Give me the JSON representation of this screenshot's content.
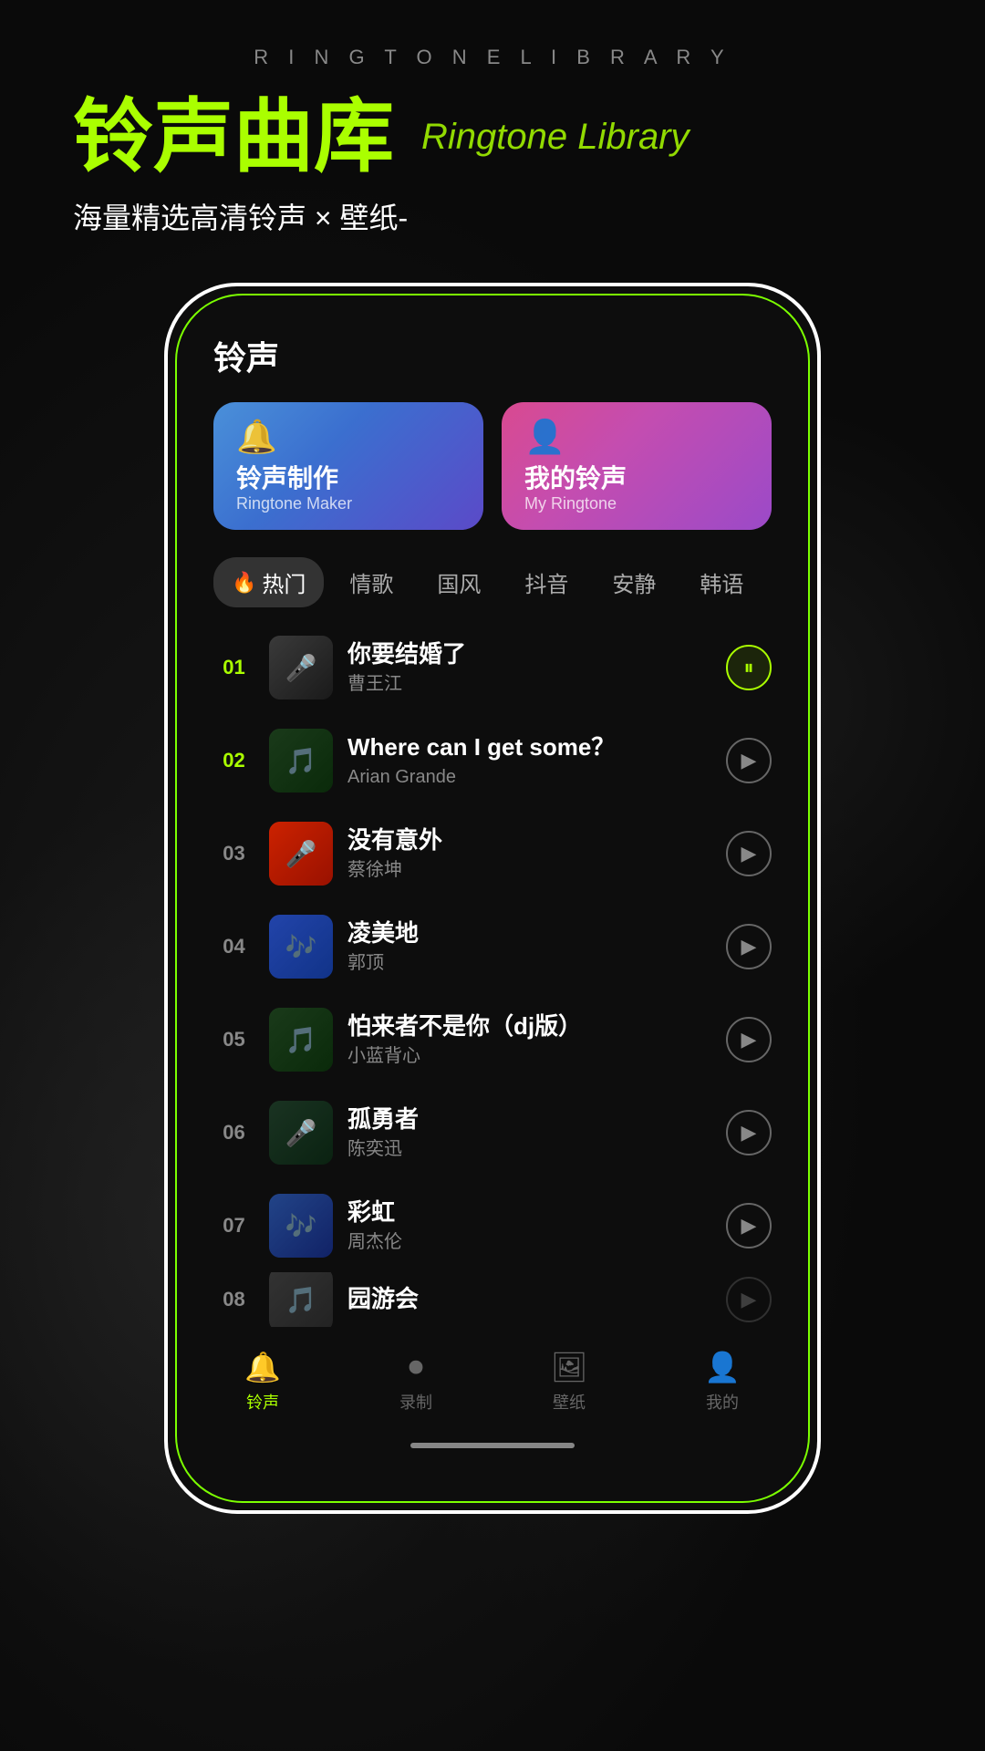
{
  "page": {
    "header_subtitle": "R I N G T O N E   L I B R A R Y",
    "title_cn": "铃声曲库",
    "title_en": "Ringtone Library",
    "description": "海量精选高清铃声 × 壁纸-"
  },
  "phone": {
    "section_title": "铃声",
    "buttons": [
      {
        "id": "ringtone-maker",
        "icon": "🔔",
        "label_cn": "铃声制作",
        "label_en": "Ringtone Maker"
      },
      {
        "id": "my-ringtone",
        "icon": "👤",
        "label_cn": "我的铃声",
        "label_en": "My Ringtone"
      }
    ],
    "categories": [
      {
        "id": "hot",
        "label": "热门",
        "active": true,
        "has_fire": true
      },
      {
        "id": "love",
        "label": "情歌",
        "active": false
      },
      {
        "id": "chinese",
        "label": "国风",
        "active": false
      },
      {
        "id": "douyin",
        "label": "抖音",
        "active": false
      },
      {
        "id": "quiet",
        "label": "安静",
        "active": false
      },
      {
        "id": "korean",
        "label": "韩语",
        "active": false
      }
    ],
    "songs": [
      {
        "number": "01",
        "number_highlighted": true,
        "title": "你要结婚了",
        "artist": "曹王江",
        "playing": true,
        "thumb_class": "thumb-p1"
      },
      {
        "number": "02",
        "number_highlighted": true,
        "title": "Where can I get some？",
        "artist": "Arian Grande",
        "playing": false,
        "thumb_class": "thumb-p2"
      },
      {
        "number": "03",
        "number_highlighted": false,
        "title": "没有意外",
        "artist": "蔡徐坤",
        "playing": false,
        "thumb_class": "thumb-p3"
      },
      {
        "number": "04",
        "number_highlighted": false,
        "title": "凌美地",
        "artist": "郭顶",
        "playing": false,
        "thumb_class": "thumb-p4"
      },
      {
        "number": "05",
        "number_highlighted": false,
        "title": "怕来者不是你（dj版）",
        "artist": "小蓝背心",
        "playing": false,
        "thumb_class": "thumb-p5"
      },
      {
        "number": "06",
        "number_highlighted": false,
        "title": "孤勇者",
        "artist": "陈奕迅",
        "playing": false,
        "thumb_class": "thumb-p6"
      },
      {
        "number": "07",
        "number_highlighted": false,
        "title": "彩虹",
        "artist": "周杰伦",
        "playing": false,
        "thumb_class": "thumb-p7"
      },
      {
        "number": "08",
        "number_highlighted": false,
        "title": "园游会",
        "artist": "",
        "playing": false,
        "thumb_class": "thumb-p8",
        "partial": true
      }
    ],
    "bottom_nav": [
      {
        "id": "ringtone",
        "icon": "🔔",
        "label": "铃声",
        "active": true
      },
      {
        "id": "record",
        "icon": "⏺",
        "label": "录制",
        "active": false
      },
      {
        "id": "wallpaper",
        "icon": "🖼",
        "label": "壁纸",
        "active": false
      },
      {
        "id": "mine",
        "icon": "👤",
        "label": "我的",
        "active": false
      }
    ]
  }
}
